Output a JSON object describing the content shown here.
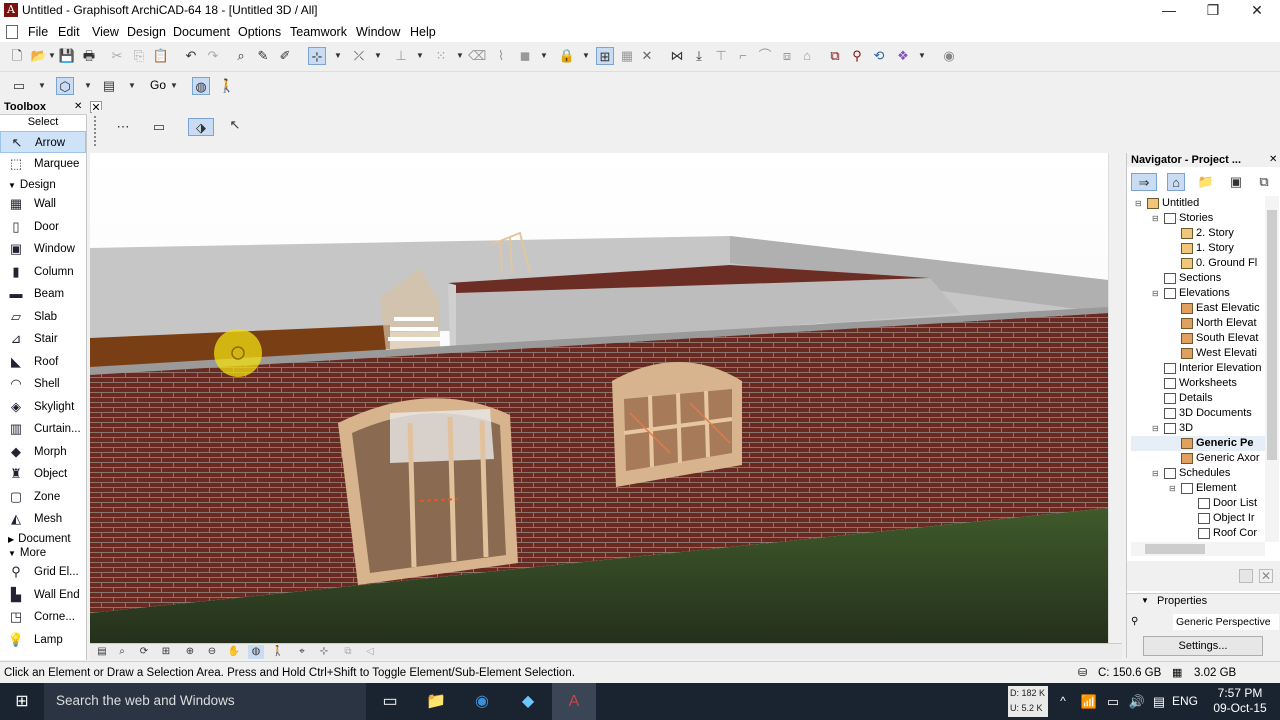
{
  "window": {
    "title": "Untitled - Graphisoft ArchiCAD-64 18 - [Untitled 3D / All]",
    "app_icon": "A",
    "minimize": "—",
    "restore": "❐",
    "close": "✕"
  },
  "menubar": [
    "File",
    "Edit",
    "View",
    "Design",
    "Document",
    "Options",
    "Teamwork",
    "Window",
    "Help"
  ],
  "toolbar2": {
    "go_label": "Go"
  },
  "toolbox": {
    "title": "Toolbox",
    "close": "✕",
    "select_label": "Select",
    "tools_select": [
      {
        "label": "Arrow",
        "icon": "arrow-icon",
        "glyph": "↖",
        "selected": true
      },
      {
        "label": "Marquee",
        "icon": "marquee-icon",
        "glyph": "⬚",
        "selected": false
      }
    ],
    "design_group": "Design",
    "tools_design": [
      {
        "label": "Wall",
        "icon": "wall-icon",
        "glyph": "▦"
      },
      {
        "label": "Door",
        "icon": "door-icon",
        "glyph": "▯"
      },
      {
        "label": "Window",
        "icon": "window-icon",
        "glyph": "▣"
      },
      {
        "label": "Column",
        "icon": "column-icon",
        "glyph": "▮"
      },
      {
        "label": "Beam",
        "icon": "beam-icon",
        "glyph": "▬"
      },
      {
        "label": "Slab",
        "icon": "slab-icon",
        "glyph": "▱"
      },
      {
        "label": "Stair",
        "icon": "stair-icon",
        "glyph": "⊿"
      },
      {
        "label": "Roof",
        "icon": "roof-icon",
        "glyph": "◣"
      },
      {
        "label": "Shell",
        "icon": "shell-icon",
        "glyph": "◠"
      },
      {
        "label": "Skylight",
        "icon": "skylight-icon",
        "glyph": "◈"
      },
      {
        "label": "Curtain...",
        "icon": "curtain-wall-icon",
        "glyph": "▥"
      },
      {
        "label": "Morph",
        "icon": "morph-icon",
        "glyph": "◆"
      },
      {
        "label": "Object",
        "icon": "object-icon",
        "glyph": "♜"
      },
      {
        "label": "Zone",
        "icon": "zone-icon",
        "glyph": "▢"
      },
      {
        "label": "Mesh",
        "icon": "mesh-icon",
        "glyph": "◭"
      }
    ],
    "document_group": "Document",
    "more_group": "More",
    "tools_more": [
      {
        "label": "Grid El...",
        "icon": "grid-element-icon",
        "glyph": "⚲"
      },
      {
        "label": "Wall End",
        "icon": "wall-end-icon",
        "glyph": "▙"
      },
      {
        "label": "Corne...",
        "icon": "corner-window-icon",
        "glyph": "◳"
      },
      {
        "label": "Lamp",
        "icon": "lamp-icon",
        "glyph": "💡"
      }
    ]
  },
  "navigator": {
    "title": "Navigator - Project ...",
    "close": "✕",
    "tree": [
      {
        "label": "Untitled",
        "level": 0,
        "toggle": "⊟",
        "type": "fold",
        "bold": false
      },
      {
        "label": "Stories",
        "level": 1,
        "toggle": "⊟",
        "type": "doc",
        "bold": false
      },
      {
        "label": "2. Story",
        "level": 2,
        "toggle": "",
        "type": "fold",
        "bold": false
      },
      {
        "label": "1. Story",
        "level": 2,
        "toggle": "",
        "type": "fold",
        "bold": false
      },
      {
        "label": "0. Ground Fl",
        "level": 2,
        "toggle": "",
        "type": "fold",
        "bold": false
      },
      {
        "label": "Sections",
        "level": 1,
        "toggle": "",
        "type": "doc",
        "bold": false
      },
      {
        "label": "Elevations",
        "level": 1,
        "toggle": "⊟",
        "type": "doc",
        "bold": false
      },
      {
        "label": "East Elevatic",
        "level": 2,
        "toggle": "",
        "type": "house",
        "bold": false
      },
      {
        "label": "North Elevat",
        "level": 2,
        "toggle": "",
        "type": "house",
        "bold": false
      },
      {
        "label": "South Elevat",
        "level": 2,
        "toggle": "",
        "type": "house",
        "bold": false
      },
      {
        "label": "West Elevati",
        "level": 2,
        "toggle": "",
        "type": "house",
        "bold": false
      },
      {
        "label": "Interior Elevation",
        "level": 1,
        "toggle": "",
        "type": "doc",
        "bold": false
      },
      {
        "label": "Worksheets",
        "level": 1,
        "toggle": "",
        "type": "doc",
        "bold": false
      },
      {
        "label": "Details",
        "level": 1,
        "toggle": "",
        "type": "doc",
        "bold": false
      },
      {
        "label": "3D Documents",
        "level": 1,
        "toggle": "",
        "type": "doc",
        "bold": false
      },
      {
        "label": "3D",
        "level": 1,
        "toggle": "⊟",
        "type": "doc",
        "bold": false
      },
      {
        "label": "Generic Pe",
        "level": 2,
        "toggle": "",
        "type": "house",
        "bold": true
      },
      {
        "label": "Generic Axor",
        "level": 2,
        "toggle": "",
        "type": "house",
        "bold": false
      },
      {
        "label": "Schedules",
        "level": 1,
        "toggle": "⊟",
        "type": "doc",
        "bold": false
      },
      {
        "label": "Element",
        "level": 2,
        "toggle": "⊟",
        "type": "doc",
        "bold": false
      },
      {
        "label": "Door List",
        "level": 3,
        "toggle": "",
        "type": "doc",
        "bold": false
      },
      {
        "label": "Object Ir",
        "level": 3,
        "toggle": "",
        "type": "doc",
        "bold": false
      },
      {
        "label": "Roof Cor",
        "level": 3,
        "toggle": "",
        "type": "doc",
        "bold": false
      }
    ],
    "properties_label": "Properties",
    "properties_value": "Generic Perspective",
    "settings_button": "Settings..."
  },
  "status": {
    "hint": "Click an Element or Draw a Selection Area. Press and Hold Ctrl+Shift to Toggle Element/Sub-Element Selection.",
    "disk": "C: 150.6 GB",
    "memory": "3.02 GB"
  },
  "taskbar": {
    "search_placeholder": "Search the web and Windows",
    "net_down": "D: 182 K",
    "net_up": "U: 5.2 K",
    "language": "ENG",
    "time": "7:57 PM",
    "date": "09-Oct-15"
  }
}
